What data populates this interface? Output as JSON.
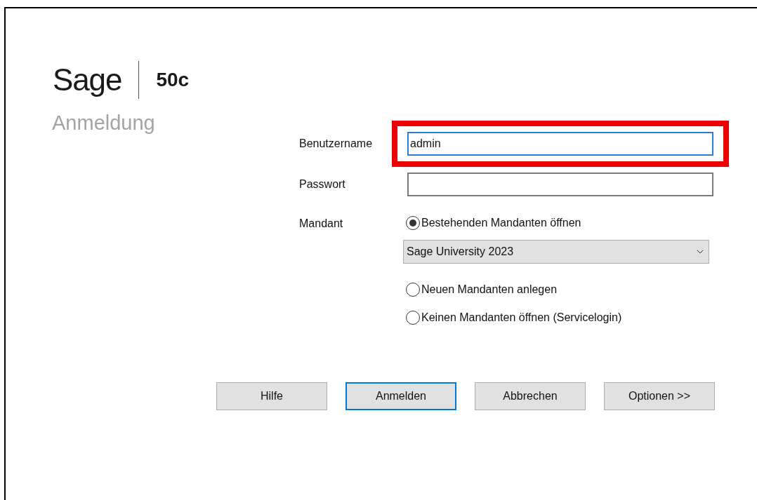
{
  "logo": {
    "brand": "Sage",
    "product": "50c"
  },
  "heading": "Anmeldung",
  "fields": [
    {
      "label": "Benutzername",
      "value": "admin",
      "focused": true,
      "highlighted": true
    },
    {
      "label": "Passwort",
      "focused": false,
      "highlighted": false
    }
  ],
  "mandant": {
    "label": "Mandant",
    "options": [
      {
        "label": "Bestehenden Mandanten öffnen",
        "selected": true
      },
      {
        "label": "Neuen Mandanten anlegen",
        "selected": false
      },
      {
        "label": "Keinen Mandanten öffnen (Servicelogin)",
        "selected": false
      }
    ],
    "dropdown": {
      "value": "Sage University 2023"
    }
  },
  "buttons": [
    {
      "label": "Hilfe",
      "default": false
    },
    {
      "label": "Anmelden",
      "default": true
    },
    {
      "label": "Abbrechen",
      "default": false
    },
    {
      "label": "Optionen >>",
      "default": false
    }
  ]
}
